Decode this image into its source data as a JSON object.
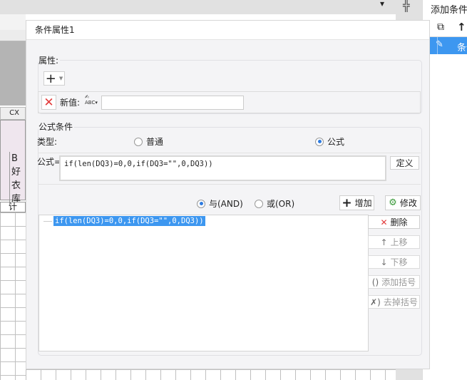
{
  "background": {
    "column_header": "CX",
    "cell_text": "B好衣库",
    "cell_calc": "计"
  },
  "right_panel": {
    "title": "添加条件",
    "selected_item": "条件"
  },
  "dialog": {
    "title": "条件属性1",
    "attributes": {
      "label": "属性:",
      "new_value_label": "新值:",
      "new_value": ""
    },
    "formula_condition": {
      "label": "公式条件",
      "type_label": "类型:",
      "type_options": [
        "普通",
        "公式"
      ],
      "type_selected": "公式",
      "formula_label": "公式=",
      "formula_value": "if(len(DQ3)=0,0,if(DQ3=\"\",0,DQ3))",
      "define_button": "定义",
      "and_label": "与(AND)",
      "or_label": "或(OR)",
      "logic_selected": "与(AND)",
      "add_button": "增加",
      "modify_button": "修改",
      "conditions": [
        "if(len(DQ3)=0,0,if(DQ3=\"\",0,DQ3))"
      ],
      "delete_button": "删除",
      "move_up_button": "上移",
      "move_down_button": "下移",
      "add_bracket_button": "添加括号",
      "remove_bracket_button": "去掉括号"
    }
  }
}
